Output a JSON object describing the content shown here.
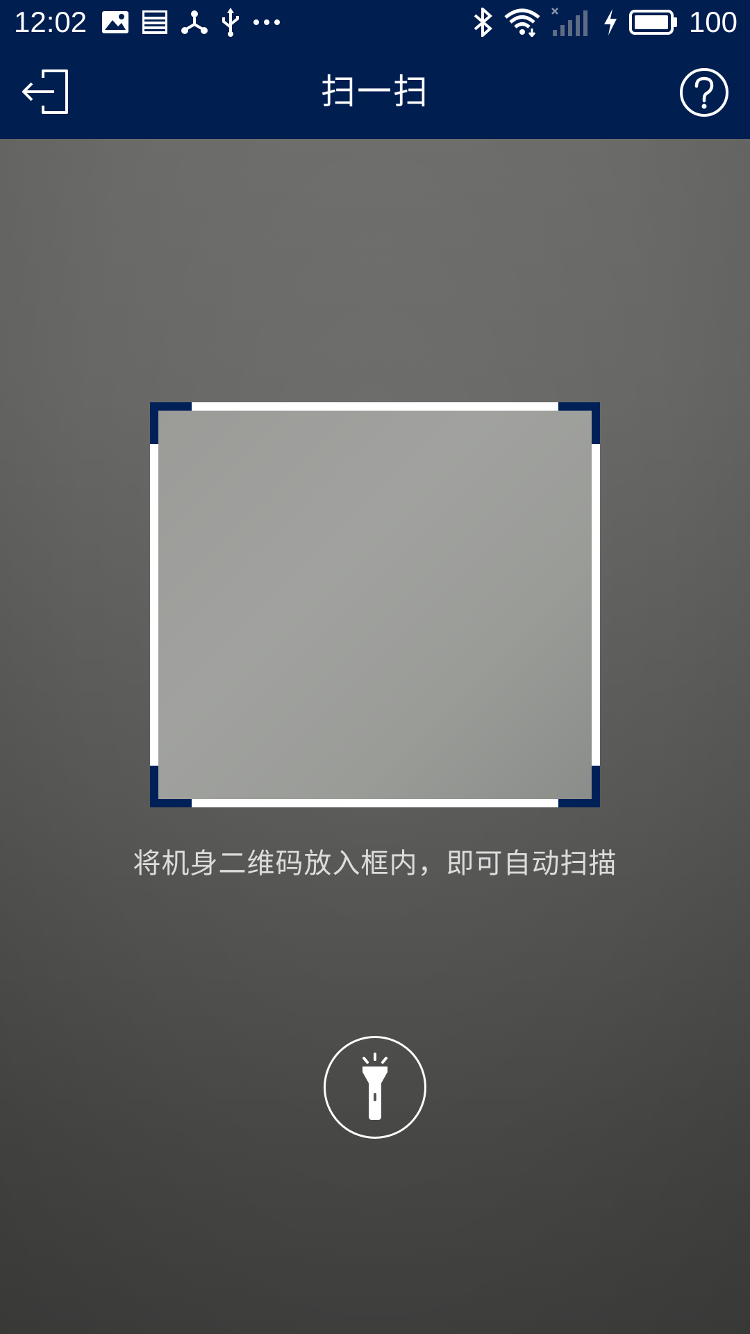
{
  "status_bar": {
    "time": "12:02",
    "battery_level": "100",
    "left_icons": [
      "image-icon",
      "news-icon",
      "share-node-icon",
      "usb-icon",
      "more-dots-icon"
    ],
    "right_icons": [
      "bluetooth-icon",
      "wifi-icon",
      "signal-no-service-icon",
      "charging-icon",
      "battery-icon"
    ]
  },
  "app_bar": {
    "title": "扫一扫",
    "back_icon": "exit-icon",
    "help_icon": "help-circle-icon",
    "background_color": "#001e50"
  },
  "scanner": {
    "hint": "将机身二维码放入框内，即可自动扫描",
    "frame_color": "#ffffff",
    "corner_color": "#002157",
    "flashlight_icon": "flashlight-icon"
  }
}
